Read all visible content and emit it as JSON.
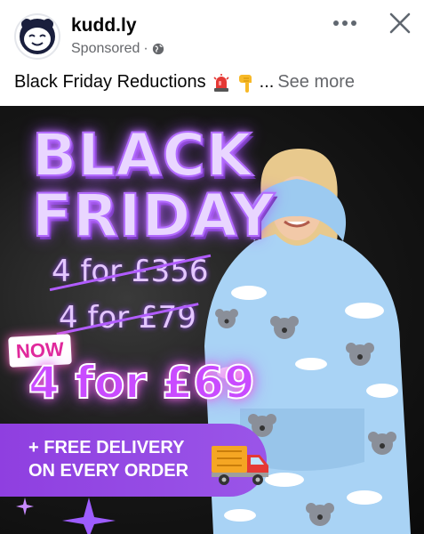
{
  "post": {
    "page_name": "kudd.ly",
    "sponsored_label": "Sponsored",
    "separator": "·",
    "caption_text": "Black Friday Reductions",
    "caption_ellipsis": "...",
    "see_more": "See more",
    "caption_emojis": [
      "siren-emoji",
      "pointing-down-emoji"
    ]
  },
  "icons": {
    "globe": "globe-icon",
    "more": "more-options-icon",
    "close": "close-icon"
  },
  "ad": {
    "title_line1": "BLACK",
    "title_line2": "FRIDAY",
    "old_price_1": "4 for £356",
    "old_price_2": "4 for £79",
    "now_label": "NOW",
    "new_price": "4 for £69",
    "delivery_line1": "+ FREE DELIVERY",
    "delivery_line2": "ON EVERY ORDER"
  },
  "colors": {
    "brand_purple": "#9a55e8",
    "neon_pink": "#e0289b",
    "hoodie_blue": "#a9d3f5",
    "secondary_text": "#65676b"
  }
}
